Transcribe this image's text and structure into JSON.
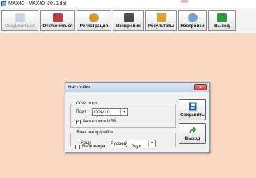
{
  "window": {
    "title": "MAX40 - MAX40_2019.dat"
  },
  "toolbar": {
    "buttons": [
      {
        "label": "Соединиться",
        "icon": "connect-icon",
        "color": "#9bb3d6",
        "enabled": false
      },
      {
        "label": "Отключиться",
        "icon": "disconnect-icon",
        "color": "#b84040",
        "enabled": true
      },
      {
        "label": "Регистрация",
        "icon": "registration-icon",
        "color": "#d39a2d",
        "enabled": true
      },
      {
        "label": "Измерение",
        "icon": "measurement-icon",
        "color": "#4a4a4a",
        "enabled": true
      },
      {
        "label": "Результаты",
        "icon": "results-icon",
        "color": "#e0a030",
        "enabled": true
      },
      {
        "label": "Настройки",
        "icon": "settings-icon",
        "color": "#7aa0d8",
        "enabled": true
      },
      {
        "label": "Выход",
        "icon": "exit-icon",
        "color": "#2f9a3f",
        "enabled": true
      }
    ]
  },
  "dialog": {
    "title": "Настройки",
    "close_label": "x",
    "com_group": {
      "label": "COM порт",
      "port_label": "Порт",
      "port_value": "COM10",
      "autosearch_label": "Авто-поиск USB",
      "autosearch_checked": true
    },
    "lang_group": {
      "label": "Язык интерфейса",
      "language_label": "Язык",
      "language_value": "Русский"
    },
    "webcam_label": "Вебкамера",
    "webcam_checked": false,
    "sound_label": "Звук",
    "sound_checked": true,
    "save_label": "Сохранить",
    "exit_label": "Выход"
  }
}
